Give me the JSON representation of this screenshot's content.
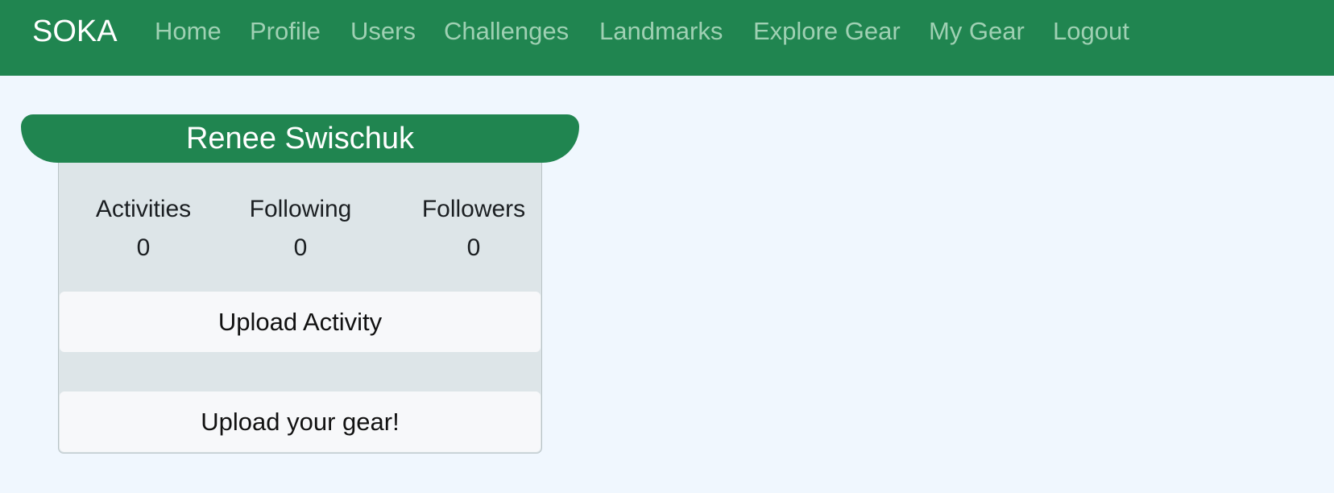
{
  "nav": {
    "brand": "SOKA",
    "links": [
      "Home",
      "Profile",
      "Users",
      "Challenges",
      "Landmarks",
      "Explore Gear",
      "My Gear",
      "Logout"
    ]
  },
  "profile": {
    "name": "Renee Swischuk",
    "stats": [
      {
        "label": "Activities",
        "value": "0"
      },
      {
        "label": "Following",
        "value": "0"
      },
      {
        "label": "Followers",
        "value": "0"
      }
    ],
    "upload_activity_label": "Upload Activity",
    "upload_gear_label": "Upload your gear!"
  },
  "colors": {
    "navbar": "#208550",
    "nav_link": "#9fd0b3",
    "page_bg": "#f0f7fe",
    "card_bg": "#dde5e8"
  }
}
